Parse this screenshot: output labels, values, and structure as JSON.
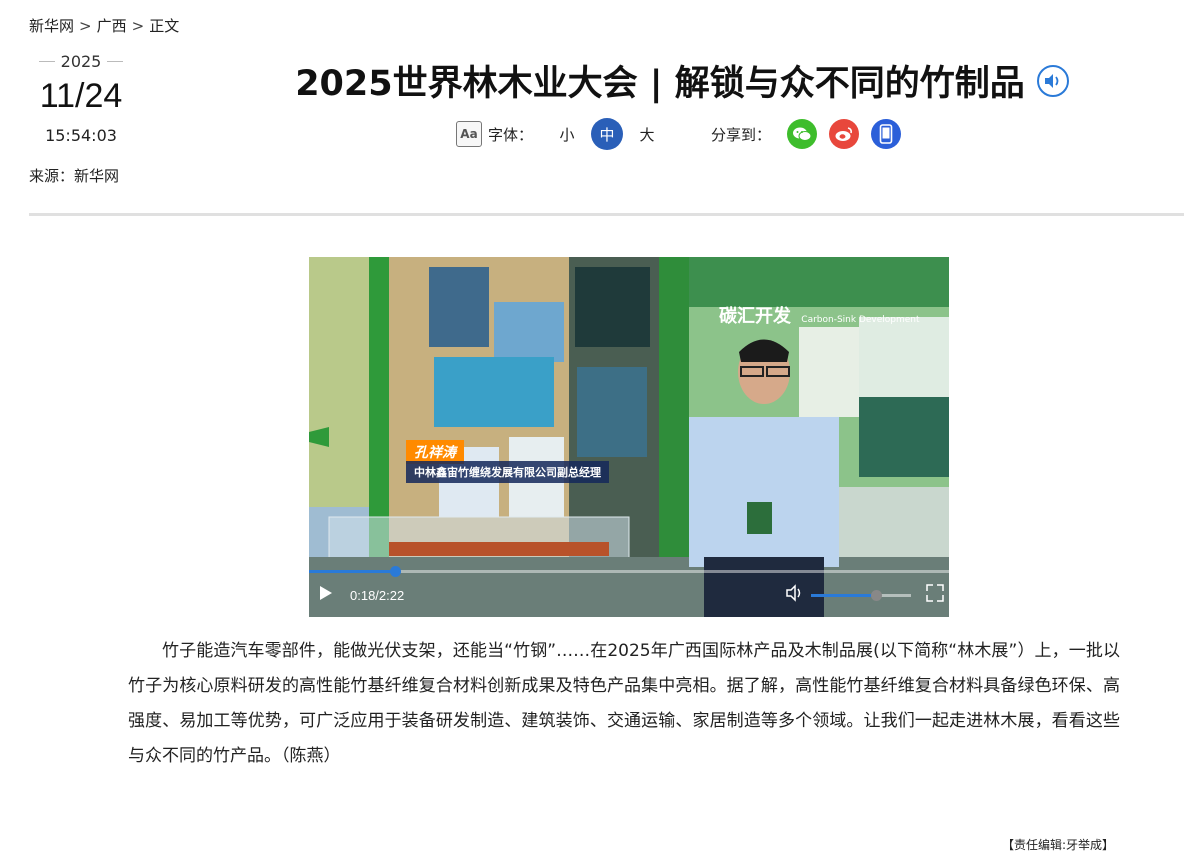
{
  "breadcrumb": {
    "items": [
      "新华网",
      "广西",
      "正文"
    ],
    "separator": ">"
  },
  "date": {
    "year": "2025",
    "day": "11/24",
    "time": "15:54:03"
  },
  "source": "来源：新华网",
  "title": "2025世界林木业大会 | 解锁与众不同的竹制品",
  "toolbar": {
    "font_label": "字体：",
    "font_sizes": [
      "小",
      "中",
      "大"
    ],
    "active_font_size": "中",
    "share_label": "分享到："
  },
  "share_icons": [
    "wechat-icon",
    "weibo-icon",
    "mobile-icon"
  ],
  "colors": {
    "accent": "#2a7ad8",
    "font_active": "#2a5fb8",
    "wechat": "#3ebd2c",
    "weibo": "#e8473c",
    "mobile": "#2b5fd9",
    "caption_orange": "#ff8a00"
  },
  "video": {
    "caption_name": "孔祥涛",
    "caption_title": "中林鑫宙竹缠绕发展有限公司副总经理",
    "sign_text": "碳汇开发",
    "sign_subtext": "Carbon-Sink Development",
    "current_time": "0:18",
    "duration": "2:22",
    "timecode": "0:18/2:22",
    "progress": 0.135,
    "volume": 0.65
  },
  "article": "竹子能造汽车零部件，能做光伏支架，还能当“竹钢”……在2025年广西国际林产品及木制品展(以下简称“林木展”）上，一批以竹子为核心原料研发的高性能竹基纤维复合材料创新成果及特色产品集中亮相。据了解，高性能竹基纤维复合材料具备绿色环保、高强度、易加工等优势，可广泛应用于装备研发制造、建筑装饰、交通运输、家居制造等多个领域。让我们一起走进林木展，看看这些与众不同的竹产品。（陈燕）",
  "editor": "【责任编辑:牙举成】"
}
